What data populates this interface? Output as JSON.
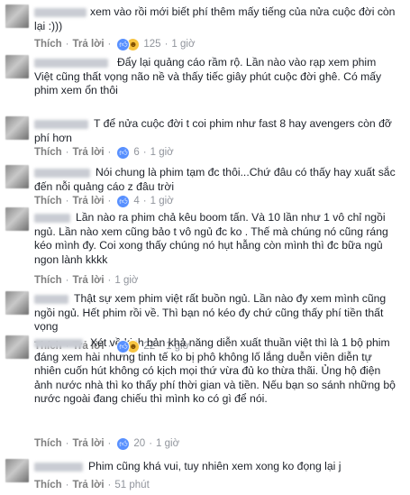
{
  "actions": {
    "like": "Thích",
    "reply": "Trả lời",
    "separator": "·"
  },
  "comments": [
    {
      "text": "xem vào rồi mới biết phí thêm mấy tiếng của nửa cuộc đời còn lại :)))",
      "reactions": 125,
      "reaction_icons": [
        "like-icon",
        "haha-icon"
      ],
      "time": "1 giờ"
    },
    {
      "text": "Đẩy lại quảng cáo rầm rộ. Lần nào vào rạp xem phim Việt cũng thất vọng não nề và thấy tiếc giây phút cuộc đời ghê. Có mấy phim xem ổn thôi",
      "time": "1 giờ"
    },
    {
      "text": "T để nửa cuộc đời t coi phim như fast 8 hay avengers còn đỡ phí hơn",
      "reactions": 6,
      "reaction_icons": [
        "like-icon"
      ],
      "time": "1 giờ"
    },
    {
      "text": "Nói chung là phim tạm đc thôi...Chứ đâu có thấy hay xuất sắc đến nỗi quảng cáo z đâu trời",
      "reactions": 4,
      "reaction_icons": [
        "like-icon"
      ],
      "time": "1 giờ"
    },
    {
      "text": "Lần nào ra phim chả kêu boom tấn. Và 10 lần như 1 vô chỉ ngồi ngủ. Lần nào xem cũng bảo t vô ngủ đc ko . Thế mà chúng nó cũng ráng kéo mình đy. Coi xong thấy chúng nó hụt hẫng còn mình thì đc bữa ngủ ngon lành kkkk",
      "time": "1 giờ"
    },
    {
      "text": "Thật sự xem phim việt rất buồn ngủ. Lần nào đy xem mình cũng ngồi ngủ. Hết phim rồi về. Thì bạn nó kéo đy chứ cũng thấy phí tiền thất vọng",
      "reactions": 22,
      "reaction_icons": [
        "like-icon",
        "haha-icon"
      ],
      "time": "1 giờ"
    },
    {
      "text": "Xét về kịch bản khả năng diễn xuất thuần việt thì là 1 bộ phim đáng xem hài nhưng tinh tế ko bị phô không lố lắng duễn viên diễn tự nhiên cuốn hút không có kịch mọi thứ vừa đủ ko thừa thãi. Ủng hộ điện ảnh nước nhà thì ko thấy phí thời gian và tiền. Nếu bạn so sánh những bộ nước ngoài đang chiếu thì mình ko có gì để nói.",
      "reactions": 20,
      "reaction_icons": [
        "like-icon"
      ],
      "time": "1 giờ"
    },
    {
      "text": "Phim cũng khá vui, tuy nhiên xem xong ko đọng lại j",
      "time": "51 phút"
    }
  ]
}
